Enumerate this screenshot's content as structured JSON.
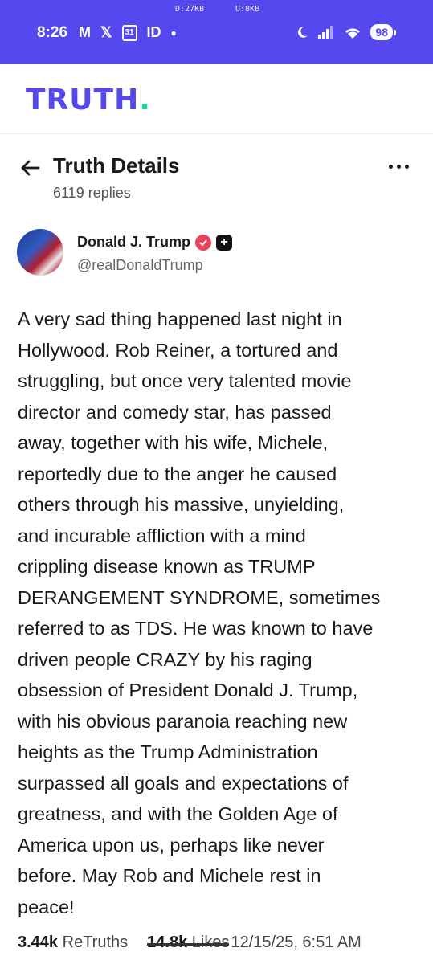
{
  "status_bar": {
    "net_down": "D:27KB",
    "net_up": "U:8KB",
    "time": "8:26",
    "calendar_day": "31",
    "battery": "98"
  },
  "app": {
    "logo_text": "TRUTH",
    "logo_dot": "."
  },
  "header": {
    "title": "Truth Details",
    "replies": "6119 replies"
  },
  "post": {
    "author_name": "Donald J. Trump",
    "handle": "@realDonaldTrump",
    "body": "A very sad thing happened last night in\nHollywood. Rob Reiner, a tortured and\nstruggling, but once very talented movie\ndirector and comedy star, has passed\naway, together with his wife, Michele,\nreportedly due to the anger he caused\nothers through his massive, unyielding,\nand incurable affliction with a mind\ncrippling disease known as TRUMP\nDERANGEMENT SYNDROME, sometimes\nreferred to as TDS. He was known to have\ndriven people CRAZY by his raging\nobsession of President Donald J. Trump,\nwith his obvious paranoia reaching new\nheights as the Trump Administration\nsurpassed all goals and expectations of\ngreatness, and with the Golden Age of\nAmerica upon us, perhaps like never\nbefore. May Rob and Michele rest in\npeace!",
    "retruths_count": "3.44k",
    "retruths_label": "ReTruths",
    "likes_count": "14.8k",
    "likes_label": "Likes",
    "date": "12/15/25, 6:51 AM"
  },
  "colors": {
    "brand": "#5448ee",
    "logo_dot": "#1ed6a2",
    "verified": "#e8425c"
  }
}
